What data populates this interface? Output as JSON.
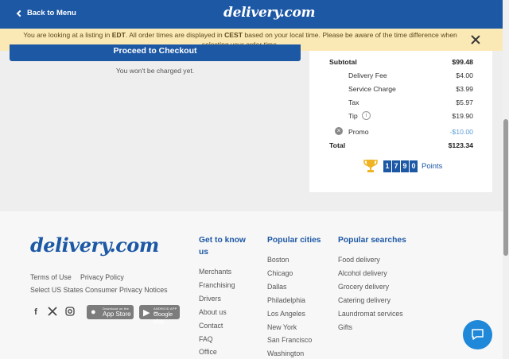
{
  "header": {
    "back_label": "Back to Menu",
    "brand": "delivery.com"
  },
  "banner": {
    "part1": "You are looking at a listing in ",
    "tz_listing": "EDT",
    "part2": ". All order times are displayed in ",
    "tz_local": "CEST",
    "part3": " based on your local time. Please be aware of the time difference when selecting your order time."
  },
  "checkout": {
    "button_label": "Proceed to Checkout",
    "note": "You won't be charged yet."
  },
  "summary": {
    "subtotal_label": "Subtotal",
    "subtotal_value": "$99.48",
    "delivery_fee_label": "Delivery Fee",
    "delivery_fee_value": "$4.00",
    "service_charge_label": "Service Charge",
    "service_charge_value": "$3.99",
    "tax_label": "Tax",
    "tax_value": "$5.97",
    "tip_label": "Tip",
    "tip_value": "$19.90",
    "promo_label": "Promo",
    "promo_value": "-$10.00",
    "total_label": "Total",
    "total_value": "$123.34",
    "points_digits": [
      "1",
      "7",
      "9",
      "0"
    ],
    "points_label": "Points",
    "promo_color": "#5b9bd5"
  },
  "footer": {
    "logo": "delivery.com",
    "legal": {
      "terms": "Terms of Use",
      "privacy": "Privacy Policy",
      "ca_privacy": "Select US States Consumer Privacy Notices"
    },
    "badges": {
      "app_store_small": "Download on the",
      "app_store_big": "App Store",
      "google_small": "ANDROID APP ON",
      "google_big": "Google play"
    },
    "get_to_know": {
      "heading": "Get to know us",
      "links": [
        "Merchants",
        "Franchising",
        "Drivers",
        "About us",
        "Contact",
        "FAQ",
        "Office"
      ]
    },
    "popular_cities": {
      "heading": "Popular cities",
      "links": [
        "Boston",
        "Chicago",
        "Dallas",
        "Philadelphia",
        "Los Angeles",
        "New York",
        "San Francisco",
        "Washington"
      ]
    },
    "popular_searches": {
      "heading": "Popular searches",
      "links": [
        "Food delivery",
        "Alcohol delivery",
        "Grocery delivery",
        "Catering delivery",
        "Laundromat services",
        "Gifts"
      ]
    }
  },
  "colors": {
    "brand_blue": "#1d58a5",
    "banner_bg": "#fbe9b5",
    "chat_blue": "#1f88d8"
  }
}
